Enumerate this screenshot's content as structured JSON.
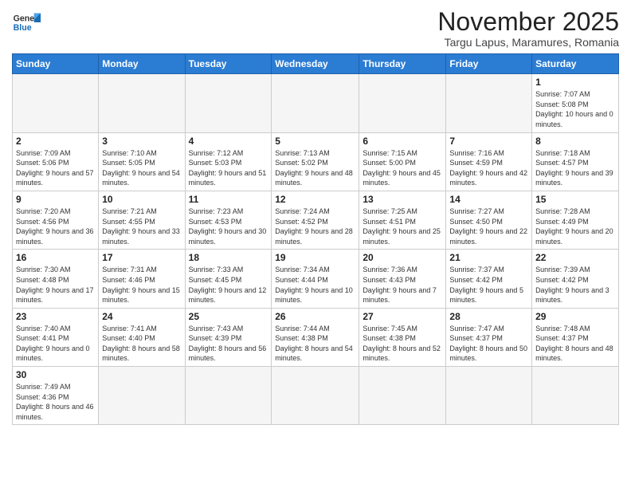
{
  "logo": {
    "line1": "General",
    "line2": "Blue"
  },
  "title": "November 2025",
  "subtitle": "Targu Lapus, Maramures, Romania",
  "days_of_week": [
    "Sunday",
    "Monday",
    "Tuesday",
    "Wednesday",
    "Thursday",
    "Friday",
    "Saturday"
  ],
  "weeks": [
    [
      {
        "num": "",
        "info": ""
      },
      {
        "num": "",
        "info": ""
      },
      {
        "num": "",
        "info": ""
      },
      {
        "num": "",
        "info": ""
      },
      {
        "num": "",
        "info": ""
      },
      {
        "num": "",
        "info": ""
      },
      {
        "num": "1",
        "info": "Sunrise: 7:07 AM\nSunset: 5:08 PM\nDaylight: 10 hours and 0 minutes."
      }
    ],
    [
      {
        "num": "2",
        "info": "Sunrise: 7:09 AM\nSunset: 5:06 PM\nDaylight: 9 hours and 57 minutes."
      },
      {
        "num": "3",
        "info": "Sunrise: 7:10 AM\nSunset: 5:05 PM\nDaylight: 9 hours and 54 minutes."
      },
      {
        "num": "4",
        "info": "Sunrise: 7:12 AM\nSunset: 5:03 PM\nDaylight: 9 hours and 51 minutes."
      },
      {
        "num": "5",
        "info": "Sunrise: 7:13 AM\nSunset: 5:02 PM\nDaylight: 9 hours and 48 minutes."
      },
      {
        "num": "6",
        "info": "Sunrise: 7:15 AM\nSunset: 5:00 PM\nDaylight: 9 hours and 45 minutes."
      },
      {
        "num": "7",
        "info": "Sunrise: 7:16 AM\nSunset: 4:59 PM\nDaylight: 9 hours and 42 minutes."
      },
      {
        "num": "8",
        "info": "Sunrise: 7:18 AM\nSunset: 4:57 PM\nDaylight: 9 hours and 39 minutes."
      }
    ],
    [
      {
        "num": "9",
        "info": "Sunrise: 7:20 AM\nSunset: 4:56 PM\nDaylight: 9 hours and 36 minutes."
      },
      {
        "num": "10",
        "info": "Sunrise: 7:21 AM\nSunset: 4:55 PM\nDaylight: 9 hours and 33 minutes."
      },
      {
        "num": "11",
        "info": "Sunrise: 7:23 AM\nSunset: 4:53 PM\nDaylight: 9 hours and 30 minutes."
      },
      {
        "num": "12",
        "info": "Sunrise: 7:24 AM\nSunset: 4:52 PM\nDaylight: 9 hours and 28 minutes."
      },
      {
        "num": "13",
        "info": "Sunrise: 7:25 AM\nSunset: 4:51 PM\nDaylight: 9 hours and 25 minutes."
      },
      {
        "num": "14",
        "info": "Sunrise: 7:27 AM\nSunset: 4:50 PM\nDaylight: 9 hours and 22 minutes."
      },
      {
        "num": "15",
        "info": "Sunrise: 7:28 AM\nSunset: 4:49 PM\nDaylight: 9 hours and 20 minutes."
      }
    ],
    [
      {
        "num": "16",
        "info": "Sunrise: 7:30 AM\nSunset: 4:48 PM\nDaylight: 9 hours and 17 minutes."
      },
      {
        "num": "17",
        "info": "Sunrise: 7:31 AM\nSunset: 4:46 PM\nDaylight: 9 hours and 15 minutes."
      },
      {
        "num": "18",
        "info": "Sunrise: 7:33 AM\nSunset: 4:45 PM\nDaylight: 9 hours and 12 minutes."
      },
      {
        "num": "19",
        "info": "Sunrise: 7:34 AM\nSunset: 4:44 PM\nDaylight: 9 hours and 10 minutes."
      },
      {
        "num": "20",
        "info": "Sunrise: 7:36 AM\nSunset: 4:43 PM\nDaylight: 9 hours and 7 minutes."
      },
      {
        "num": "21",
        "info": "Sunrise: 7:37 AM\nSunset: 4:42 PM\nDaylight: 9 hours and 5 minutes."
      },
      {
        "num": "22",
        "info": "Sunrise: 7:39 AM\nSunset: 4:42 PM\nDaylight: 9 hours and 3 minutes."
      }
    ],
    [
      {
        "num": "23",
        "info": "Sunrise: 7:40 AM\nSunset: 4:41 PM\nDaylight: 9 hours and 0 minutes."
      },
      {
        "num": "24",
        "info": "Sunrise: 7:41 AM\nSunset: 4:40 PM\nDaylight: 8 hours and 58 minutes."
      },
      {
        "num": "25",
        "info": "Sunrise: 7:43 AM\nSunset: 4:39 PM\nDaylight: 8 hours and 56 minutes."
      },
      {
        "num": "26",
        "info": "Sunrise: 7:44 AM\nSunset: 4:38 PM\nDaylight: 8 hours and 54 minutes."
      },
      {
        "num": "27",
        "info": "Sunrise: 7:45 AM\nSunset: 4:38 PM\nDaylight: 8 hours and 52 minutes."
      },
      {
        "num": "28",
        "info": "Sunrise: 7:47 AM\nSunset: 4:37 PM\nDaylight: 8 hours and 50 minutes."
      },
      {
        "num": "29",
        "info": "Sunrise: 7:48 AM\nSunset: 4:37 PM\nDaylight: 8 hours and 48 minutes."
      }
    ],
    [
      {
        "num": "30",
        "info": "Sunrise: 7:49 AM\nSunset: 4:36 PM\nDaylight: 8 hours and 46 minutes."
      },
      {
        "num": "",
        "info": ""
      },
      {
        "num": "",
        "info": ""
      },
      {
        "num": "",
        "info": ""
      },
      {
        "num": "",
        "info": ""
      },
      {
        "num": "",
        "info": ""
      },
      {
        "num": "",
        "info": ""
      }
    ]
  ]
}
